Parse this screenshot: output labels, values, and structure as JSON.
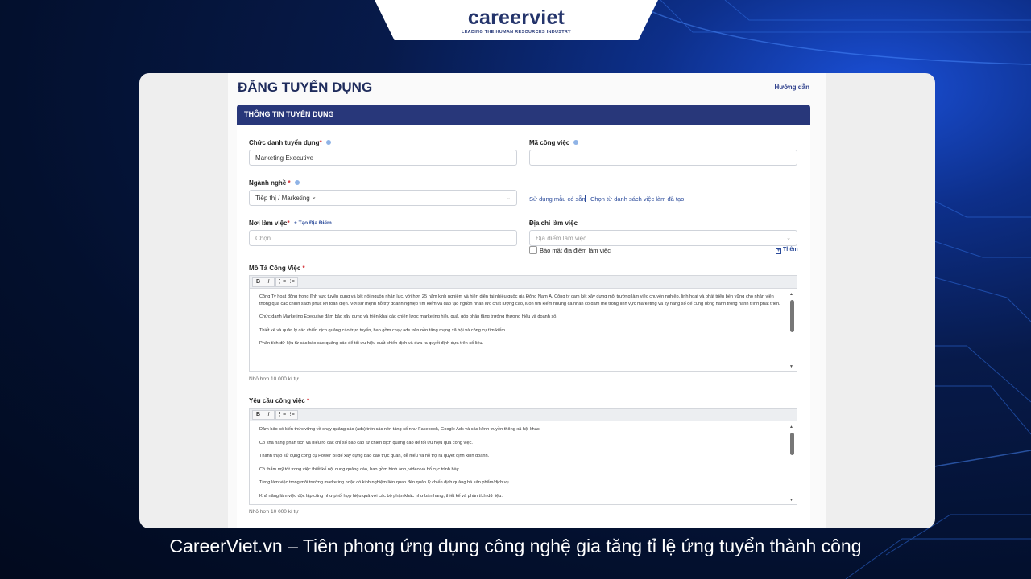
{
  "brand": {
    "logo": "careerviet",
    "tagline": "LEADING THE HUMAN RESOURCES INDUSTRY"
  },
  "page": {
    "title": "ĐĂNG TUYỂN DỤNG",
    "guide_link": "Hướng dẫn",
    "section_title": "THÔNG TIN TUYỂN DỤNG"
  },
  "form": {
    "job_title": {
      "label": "Chức danh tuyển dụng",
      "required": "*",
      "value": "Marketing Executive"
    },
    "job_code": {
      "label": "Mã công việc",
      "value": ""
    },
    "industry": {
      "label": "Ngành nghề",
      "required": "*",
      "selected": "Tiếp thị / Marketing",
      "remove": "×"
    },
    "templates": {
      "use_template": "Sử dụng mẫu có sẵn",
      "choose_list": "Chọn từ danh sách việc làm đã tạo"
    },
    "work_place": {
      "label": "Nơi làm việc",
      "required": "*",
      "create_link": "+ Tạo Địa Điểm",
      "placeholder": "Chọn"
    },
    "work_address": {
      "label": "Địa chỉ làm việc",
      "placeholder": "Địa điểm làm việc",
      "privacy": "Bảo mật địa điểm làm việc",
      "add": "Thêm"
    },
    "description": {
      "label": "Mô Tả Công Việc",
      "required": "*",
      "paragraphs": [
        "Công Ty hoạt động trong lĩnh vực tuyển dụng và kết nối nguồn nhân lực, với hơn 25 năm kinh nghiệm và hiện diện tại nhiều quốc gia Đông Nam Á. Công ty cam kết xây dựng môi trường làm việc chuyên nghiệp, linh hoạt và phát triển bền vững cho nhân viên thông qua các chính sách phúc lợi toàn diện. Với sứ mệnh hỗ trợ doanh nghiệp tìm kiếm và đào tạo nguồn nhân lực chất lượng cao, luôn tìm kiếm những cá nhân có đam mê trong lĩnh vực marketing và kỹ năng số để cùng đồng hành trong hành trình phát triển.",
        "Chức danh Marketing Executive đảm bảo xây dựng và triển khai các chiến lược marketing hiệu quả, góp phần tăng trưởng thương hiệu và doanh số.",
        "Thiết kế và quản lý các chiến dịch quảng cáo trực tuyến, bao gồm chạy ads trên nền tảng mạng xã hội và công cụ tìm kiếm.",
        "Phân tích dữ liệu từ các báo cáo quảng cáo để tối ưu hiệu suất chiến dịch và đưa ra quyết định dựa trên số liệu."
      ],
      "hint": "Nhỏ hơn 10 000 kí tự"
    },
    "requirements": {
      "label": "Yêu cầu công việc",
      "required": "*",
      "paragraphs": [
        "Đảm bảo có kiến thức vững về chạy quảng cáo (ads) trên các nền tảng số như Facebook, Google Ads và các kênh truyền thông xã hội khác.",
        "Có khả năng phân tích và hiểu rõ các chỉ số báo cáo từ chiến dịch quảng cáo để tối ưu hiệu quả công việc.",
        "Thành thạo sử dụng công cụ Power BI để xây dựng báo cáo trực quan, dễ hiểu và hỗ trợ ra quyết định kinh doanh.",
        "Có thẩm mỹ tốt trong việc thiết kế nội dung quảng cáo, bao gồm hình ảnh, video và bố cục trình bày.",
        "Từng làm việc trong môi trường marketing hoặc có kinh nghiệm liên quan đến quản lý chiến dịch quảng bá sản phẩm/dịch vụ.",
        "Khả năng làm việc độc lập cũng như phối hợp hiệu quả với các bộ phận khác như bán hàng, thiết kế và phân tích dữ liệu."
      ],
      "hint": "Nhỏ hơn 10 000 kí tự"
    }
  },
  "toolbar": {
    "bold": "B",
    "italic": "I",
    "ordered_list": "⋮≡",
    "bullet_list": "⁝≡"
  },
  "caption": "CareerViet.vn – Tiên phong ứng dụng công nghệ gia tăng tỉ lệ ứng tuyển thành công",
  "colors": {
    "brand_navy": "#28377a",
    "accent_blue": "#2a4a9a",
    "required_red": "#d0232a"
  }
}
